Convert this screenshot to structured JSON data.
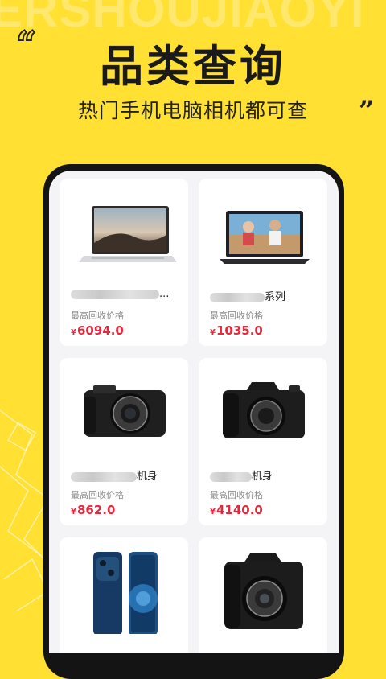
{
  "header": {
    "watermark": "ERSHOUJIAOYI",
    "quote_open": "“",
    "quote_close": "”",
    "title": "品类查询",
    "subtitle": "热门手机电脑相机都可查"
  },
  "products": [
    {
      "name_suffix": "...",
      "price_label": "最高回收价格",
      "currency": "¥",
      "price": "6094.0",
      "image": "laptop-tablet-icon"
    },
    {
      "name_suffix": "系列",
      "price_label": "最高回收价格",
      "currency": "¥",
      "price": "1035.0",
      "image": "laptop-icon"
    },
    {
      "name_suffix": "机身",
      "price_label": "最高回收价格",
      "currency": "¥",
      "price": "862.0",
      "image": "mirrorless-camera-icon"
    },
    {
      "name_suffix": "机身",
      "price_label": "最高回收价格",
      "currency": "¥",
      "price": "4140.0",
      "image": "camera-body-icon"
    },
    {
      "image": "smartphone-icon"
    },
    {
      "image": "dslr-camera-icon"
    }
  ],
  "colors": {
    "background": "#FFE033",
    "price": "#E8273B",
    "phone_frame": "#141414"
  }
}
